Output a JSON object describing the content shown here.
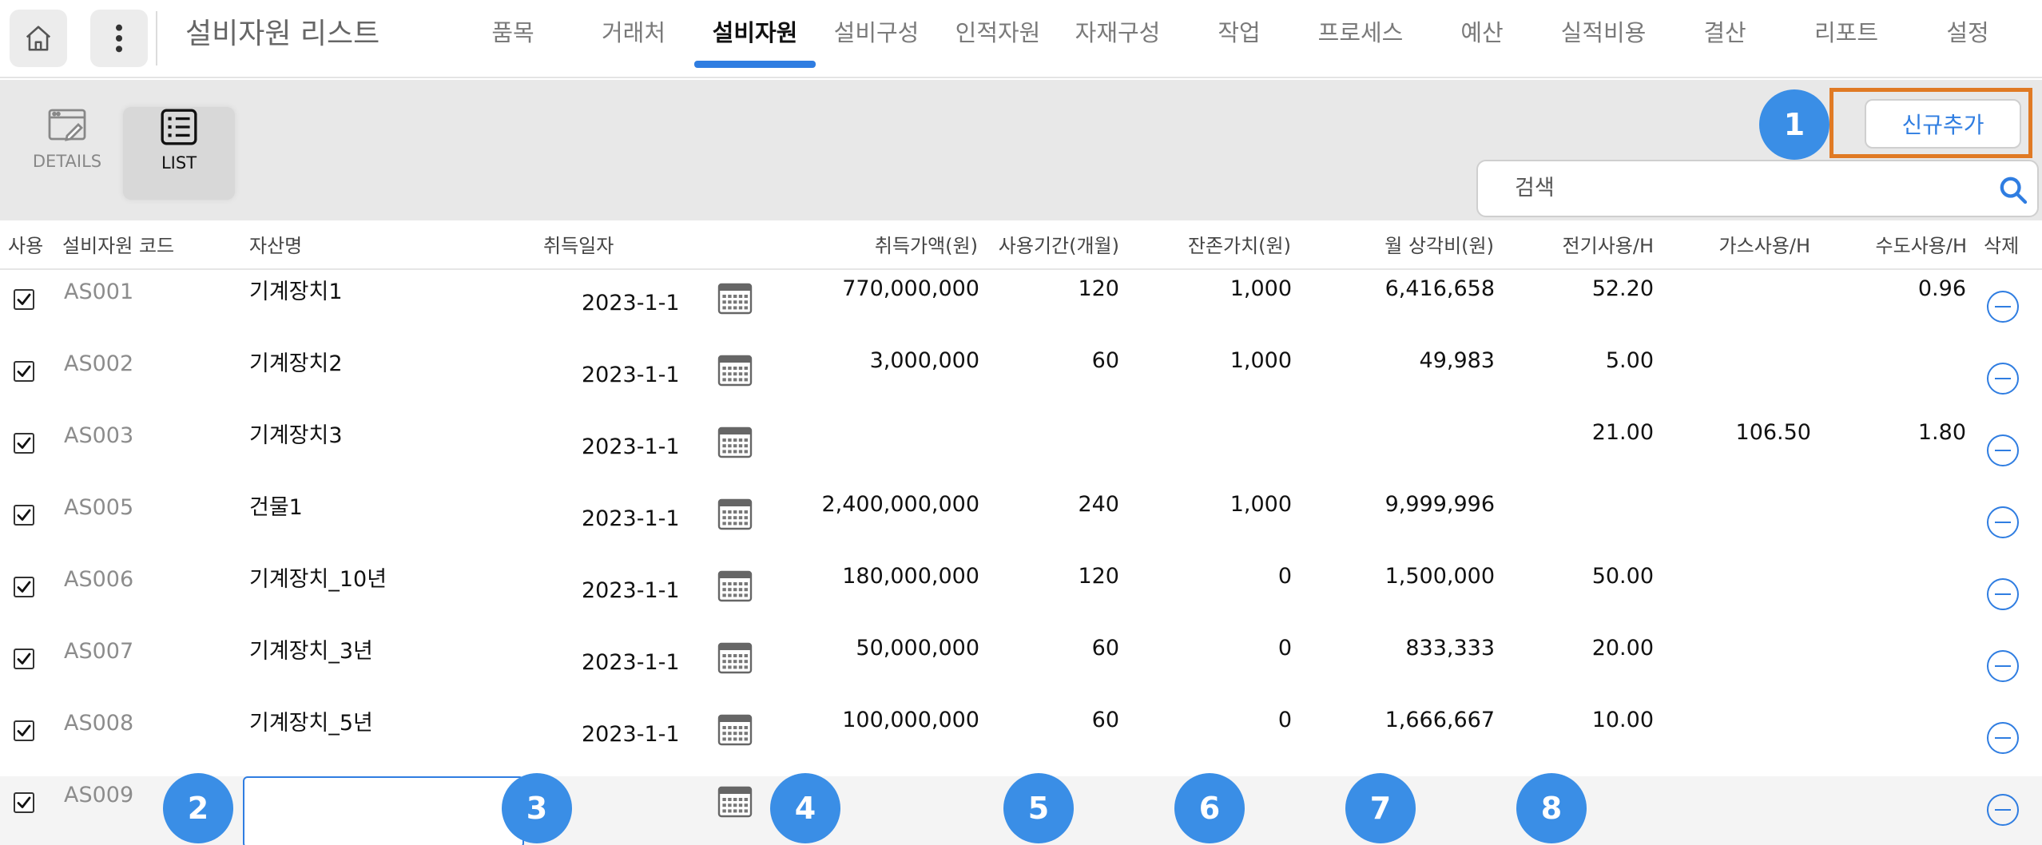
{
  "header": {
    "title": "설비자원 리스트",
    "tabs": [
      {
        "label": "품목"
      },
      {
        "label": "거래처"
      },
      {
        "label": "설비자원"
      },
      {
        "label": "설비구성"
      },
      {
        "label": "인적자원"
      },
      {
        "label": "자재구성"
      },
      {
        "label": "작업"
      },
      {
        "label": "프로세스"
      },
      {
        "label": "예산"
      },
      {
        "label": "실적비용"
      },
      {
        "label": "결산"
      },
      {
        "label": "리포트"
      },
      {
        "label": "설정"
      }
    ],
    "active_tab": "설비자원"
  },
  "toolbar": {
    "details_label": "DETAILS",
    "list_label": "LIST",
    "add_label": "신규추가",
    "search_placeholder": "검색"
  },
  "callouts": [
    "1",
    "2",
    "3",
    "4",
    "5",
    "6",
    "7",
    "8"
  ],
  "table": {
    "columns": {
      "use": "사용",
      "code": "설비자원 코드",
      "name": "자산명",
      "date": "취득일자",
      "price": "취득가액(원)",
      "period": "사용기간(개월)",
      "residual": "잔존가치(원)",
      "monthly": "월 상각비(원)",
      "elec": "전기사용/H",
      "gas": "가스사용/H",
      "water": "수도사용/H",
      "del": "삭제"
    },
    "rows": [
      {
        "checked": true,
        "code": "AS001",
        "name": "기계장치1",
        "date": "2023-1-1",
        "price": "770,000,000",
        "period": "120",
        "residual": "1,000",
        "monthly": "6,416,658",
        "elec": "52.20",
        "gas": "",
        "water": "0.96"
      },
      {
        "checked": true,
        "code": "AS002",
        "name": "기계장치2",
        "date": "2023-1-1",
        "price": "3,000,000",
        "period": "60",
        "residual": "1,000",
        "monthly": "49,983",
        "elec": "5.00",
        "gas": "",
        "water": ""
      },
      {
        "checked": true,
        "code": "AS003",
        "name": "기계장치3",
        "date": "2023-1-1",
        "price": "",
        "period": "",
        "residual": "",
        "monthly": "",
        "elec": "21.00",
        "gas": "106.50",
        "water": "1.80"
      },
      {
        "checked": true,
        "code": "AS005",
        "name": "건물1",
        "date": "2023-1-1",
        "price": "2,400,000,000",
        "period": "240",
        "residual": "1,000",
        "monthly": "9,999,996",
        "elec": "",
        "gas": "",
        "water": ""
      },
      {
        "checked": true,
        "code": "AS006",
        "name": "기계장치_10년",
        "date": "2023-1-1",
        "price": "180,000,000",
        "period": "120",
        "residual": "0",
        "monthly": "1,500,000",
        "elec": "50.00",
        "gas": "",
        "water": ""
      },
      {
        "checked": true,
        "code": "AS007",
        "name": "기계장치_3년",
        "date": "2023-1-1",
        "price": "50,000,000",
        "period": "60",
        "residual": "0",
        "monthly": "833,333",
        "elec": "20.00",
        "gas": "",
        "water": ""
      },
      {
        "checked": true,
        "code": "AS008",
        "name": "기계장치_5년",
        "date": "2023-1-1",
        "price": "100,000,000",
        "period": "60",
        "residual": "0",
        "monthly": "1,666,667",
        "elec": "10.00",
        "gas": "",
        "water": ""
      },
      {
        "checked": true,
        "code": "AS009",
        "name": "",
        "date": "",
        "price": "",
        "period": "",
        "residual": "",
        "monthly": "",
        "elec": "",
        "gas": "",
        "water": ""
      }
    ]
  },
  "colors": {
    "accent": "#2f7de1",
    "callout": "#3a8ee6",
    "highlight_box": "#e07a24"
  }
}
